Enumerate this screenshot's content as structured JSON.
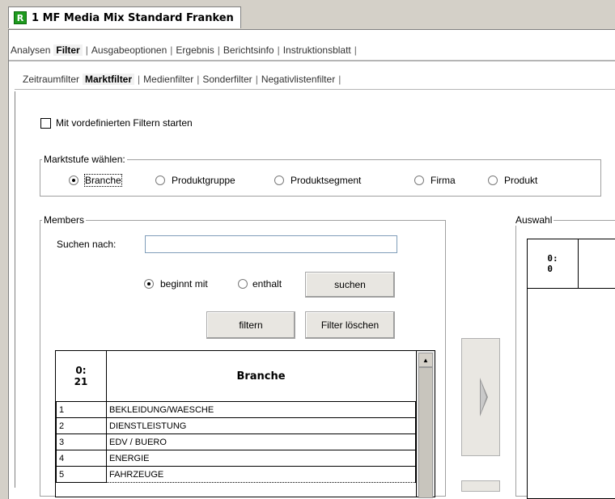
{
  "window": {
    "title": "1 MF Media Mix Standard Franken",
    "app_icon": "R"
  },
  "main_tabs": [
    "Analysen",
    "Filter",
    "Ausgabeoptionen",
    "Ergebnis",
    "Berichtsinfo",
    "Instruktionsblatt"
  ],
  "main_active": "Filter",
  "sub_tabs": [
    "Zeitraumfilter",
    "Marktfilter",
    "Medienfilter",
    "Sonderfilter",
    "Negativlistenfilter"
  ],
  "sub_active": "Marktfilter",
  "predefined": {
    "label": "Mit vordefinierten Filtern starten",
    "checked": false
  },
  "marktstufe": {
    "legend": "Marktstufe wählen:",
    "options": [
      "Branche",
      "Produktgruppe",
      "Produktsegment",
      "Firma",
      "Produkt"
    ],
    "selected": "Branche"
  },
  "members": {
    "legend": "Members",
    "search_label": "Suchen nach:",
    "search_value": "",
    "mode_options": [
      "beginnt mit",
      "enthalt"
    ],
    "mode_selected": "beginnt mit",
    "suchen": "suchen",
    "filtern": "filtern",
    "filter_loeschen": "Filter löschen",
    "grid_header_count": "0:\n21",
    "grid_header_col": "Branche",
    "rows": [
      {
        "n": "1",
        "name": "BEKLEIDUNG/WAESCHE"
      },
      {
        "n": "2",
        "name": "DIENSTLEISTUNG"
      },
      {
        "n": "3",
        "name": "EDV / BUERO"
      },
      {
        "n": "4",
        "name": "ENERGIE"
      },
      {
        "n": "5",
        "name": "FAHRZEUGE"
      }
    ]
  },
  "auswahl": {
    "legend": "Auswahl",
    "header_count": "0:\n0"
  }
}
